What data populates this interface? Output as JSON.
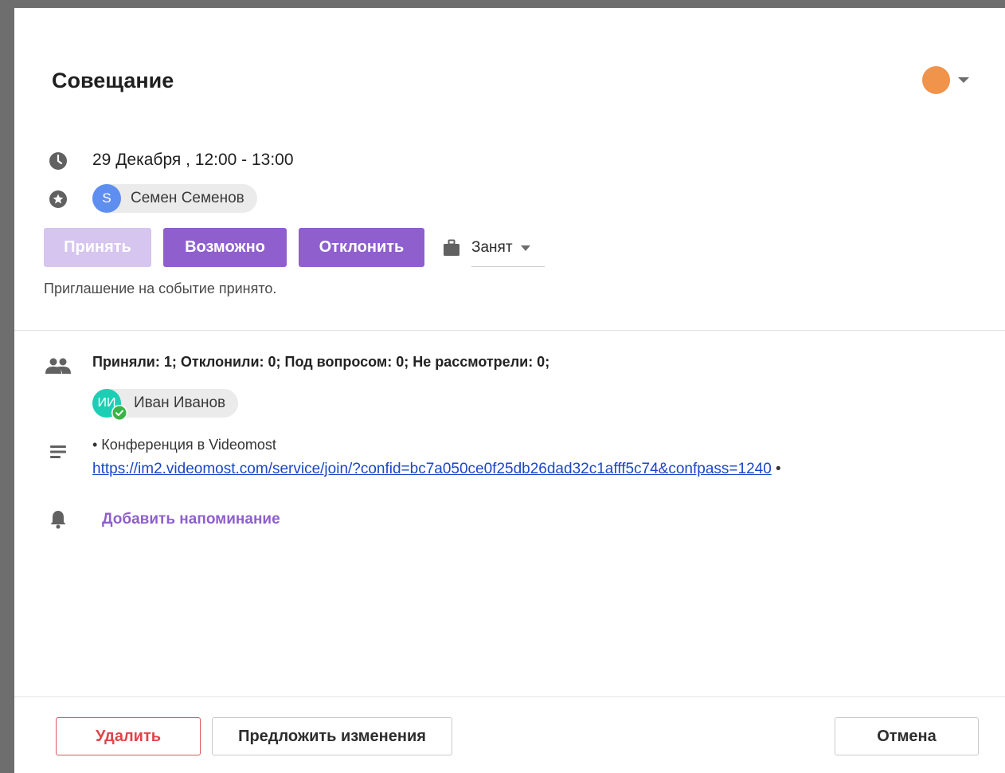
{
  "event": {
    "title": "Совещание",
    "color": "#f0934b",
    "date_time": "29 Декабря , 12:00 - 13:00"
  },
  "organizer": {
    "initial": "S",
    "name": "Семен Семенов",
    "avatar_color": "#5e8ff0"
  },
  "rsvp": {
    "accept_label": "Принять",
    "maybe_label": "Возможно",
    "decline_label": "Отклонить",
    "availability_value": "Занят",
    "status_note": "Приглашение на событие принято."
  },
  "attendees": {
    "summary": "Приняли: 1; Отклонили: 0; Под вопросом: 0; Не рассмотрели: 0;",
    "list": [
      {
        "initials": "ИИ",
        "name": "Иван Иванов",
        "avatar_color": "#1ccfb4",
        "status": "accepted"
      }
    ]
  },
  "description": {
    "line1": "• Конференция в Videomost",
    "link": "https://im2.videomost.com/service/join/?confid=bc7a050ce0f25db26dad32c1afff5c74&confpass=1240",
    "link_suffix": " •"
  },
  "reminder": {
    "add_label": "Добавить напоминание"
  },
  "footer": {
    "delete_label": "Удалить",
    "propose_label": "Предложить изменения",
    "cancel_label": "Отмена"
  },
  "icons": [
    "clock-icon",
    "star-badge-icon",
    "briefcase-icon",
    "people-icon",
    "notes-icon",
    "bell-icon",
    "check-badge-icon"
  ]
}
